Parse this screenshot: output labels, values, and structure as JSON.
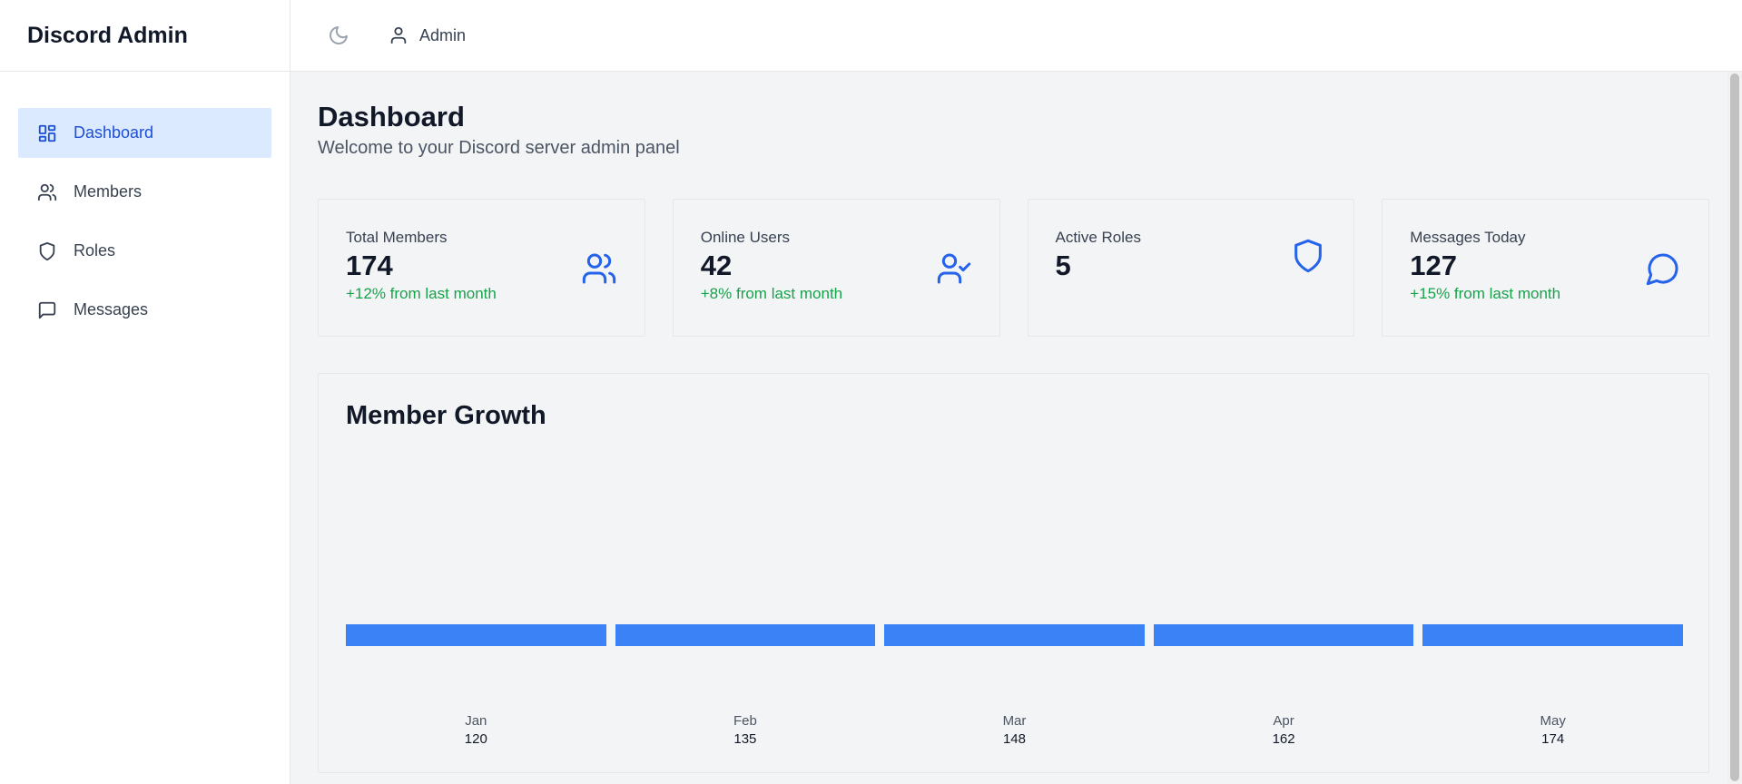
{
  "app": {
    "title": "Discord Admin"
  },
  "sidebar": {
    "items": [
      {
        "label": "Dashboard",
        "icon": "dashboard-icon",
        "active": true
      },
      {
        "label": "Members",
        "icon": "users-icon",
        "active": false
      },
      {
        "label": "Roles",
        "icon": "shield-icon",
        "active": false
      },
      {
        "label": "Messages",
        "icon": "message-icon",
        "active": false
      }
    ]
  },
  "header": {
    "user_label": "Admin",
    "theme_icon": "moon-icon",
    "user_icon": "user-icon"
  },
  "page": {
    "title": "Dashboard",
    "subtitle": "Welcome to your Discord server admin panel"
  },
  "stats": [
    {
      "label": "Total Members",
      "value": "174",
      "change": "+12% from last month",
      "icon": "users-icon"
    },
    {
      "label": "Online Users",
      "value": "42",
      "change": "+8% from last month",
      "icon": "user-check-icon"
    },
    {
      "label": "Active Roles",
      "value": "5",
      "change": "",
      "icon": "shield-icon"
    },
    {
      "label": "Messages Today",
      "value": "127",
      "change": "+15% from last month",
      "icon": "message-circle-icon"
    }
  ],
  "colors": {
    "accent": "#3b82f6",
    "active_bg": "#dbeafe",
    "active_text": "#1d4ed8",
    "positive": "#16a34a",
    "icon": "#2563eb"
  },
  "chart_data": {
    "type": "bar",
    "title": "Member Growth",
    "categories": [
      "Jan",
      "Feb",
      "Mar",
      "Apr",
      "May"
    ],
    "values": [
      120,
      135,
      148,
      162,
      174
    ],
    "data_labels": [
      "120",
      "135",
      "148",
      "162",
      "174"
    ],
    "xlabel": "",
    "ylabel": "",
    "grid": false,
    "legend": "none"
  }
}
